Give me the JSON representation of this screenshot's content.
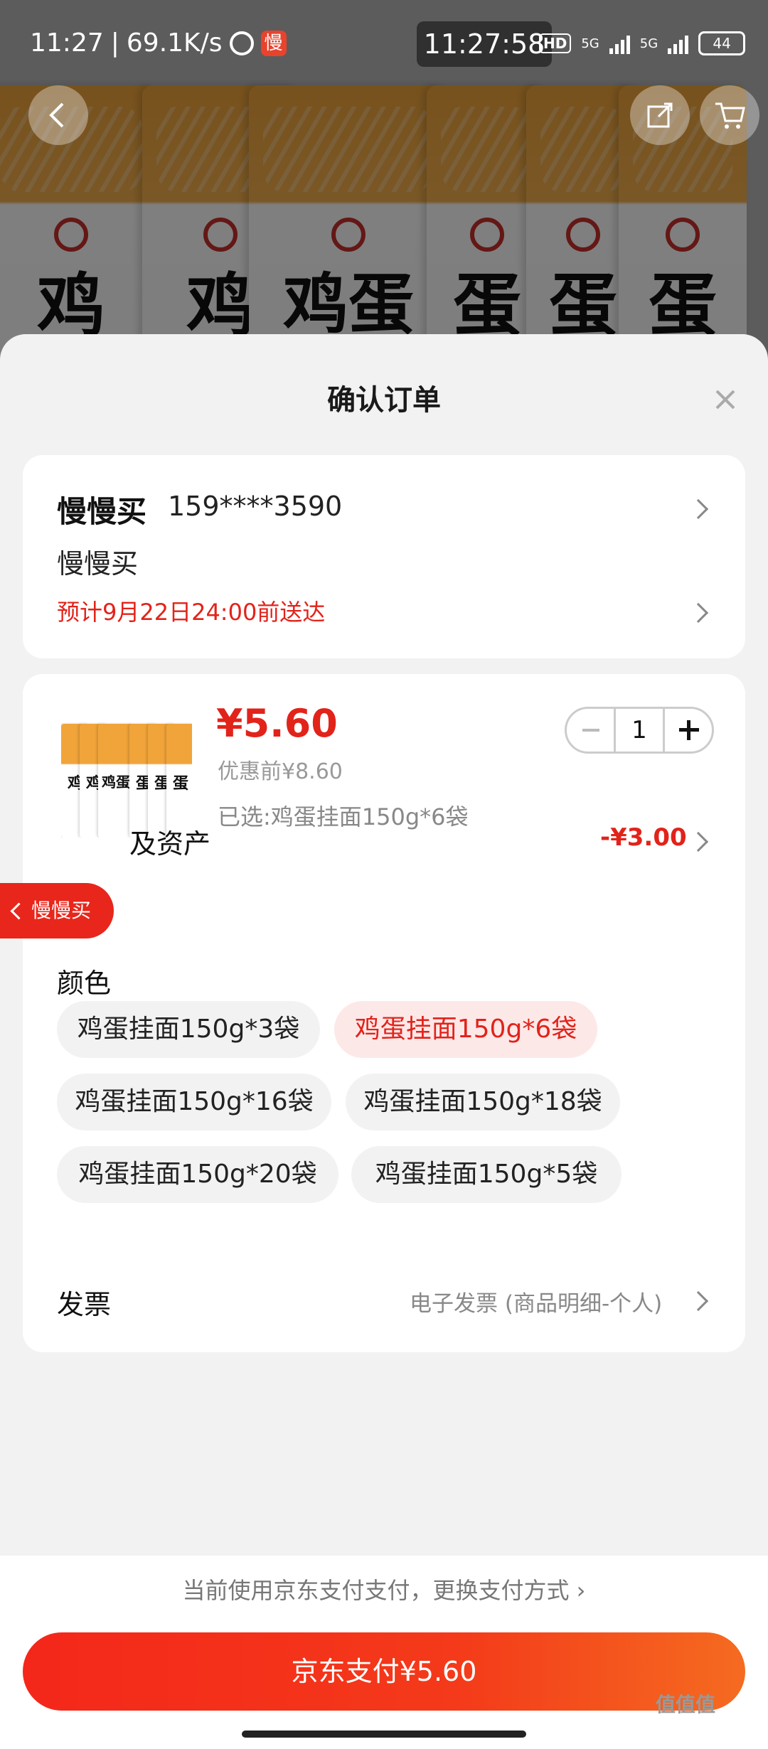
{
  "status_bar": {
    "time": "11:27",
    "network_speed": "69.1K/s",
    "app_badge": "慢",
    "clock_pill": "11:27:58",
    "hd_label": "HD",
    "net_type_1": "5G",
    "net_type_2": "5G",
    "battery": "44"
  },
  "background": {
    "bag_text": [
      "鸡",
      "鸡",
      "鸡蛋",
      "蛋",
      "蛋",
      "蛋"
    ]
  },
  "sheet": {
    "title": "确认订单"
  },
  "address": {
    "name": "慢慢买",
    "phone": "159****3590",
    "address_line": "慢慢买",
    "eta": "预计9月22日24:00前送达"
  },
  "product": {
    "price": "¥5.60",
    "original_price": "优惠前¥8.60",
    "selected_spec": "已选:鸡蛋挂面150g*6袋",
    "quantity": "1",
    "thumb_text": [
      "鸡",
      "鸡",
      "鸡蛋",
      "蛋",
      "蛋",
      "蛋"
    ]
  },
  "assets": {
    "label": "及资产",
    "value": "-¥3.00"
  },
  "color": {
    "label": "颜色",
    "options": [
      "鸡蛋挂面150g*3袋",
      "鸡蛋挂面150g*6袋",
      "鸡蛋挂面150g*16袋",
      "鸡蛋挂面150g*18袋",
      "鸡蛋挂面150g*20袋",
      "鸡蛋挂面150g*5袋"
    ],
    "selected_index": 1
  },
  "invoice": {
    "label": "发票",
    "value": "电子发票 (商品明细-个人)"
  },
  "floating_tag": {
    "label": "慢慢买"
  },
  "payment": {
    "hint": "当前使用京东支付支付，更换支付方式 ›",
    "button": "京东支付¥5.60"
  },
  "watermark": "值值值",
  "colors": {
    "accent_red": "#e2231a",
    "button_gradient_start": "#f4271a",
    "button_gradient_end": "#f56b20",
    "chip_active_bg": "#fde8e8"
  }
}
